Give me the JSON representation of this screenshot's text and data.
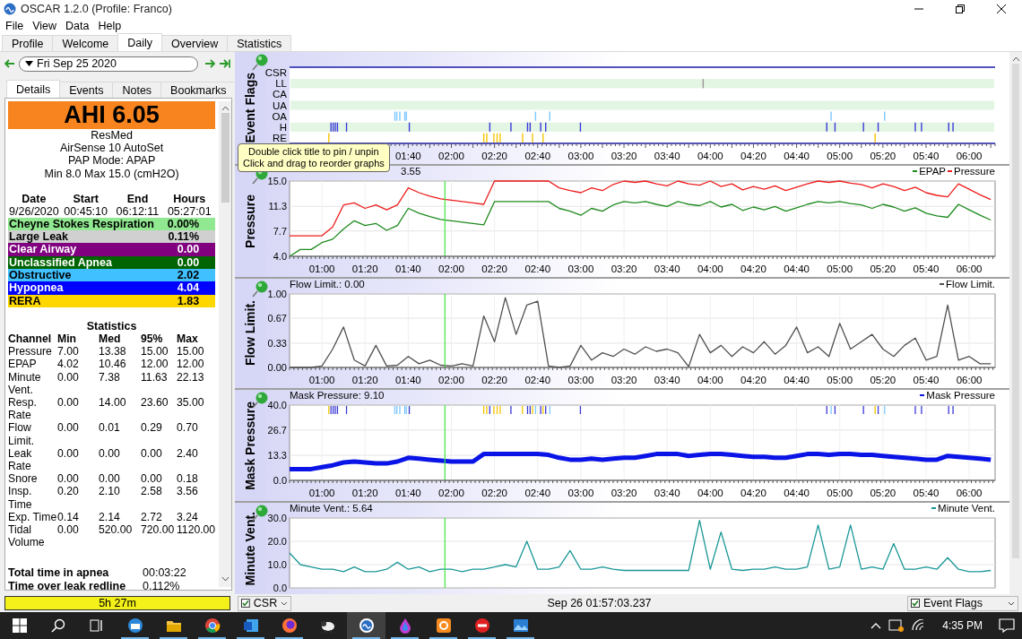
{
  "window": {
    "title": "OSCAR 1.2.0 (Profile: Franco)"
  },
  "menu": [
    "File",
    "View",
    "Data",
    "Help"
  ],
  "tabs": [
    {
      "label": "Profile",
      "selected": false
    },
    {
      "label": "Welcome",
      "selected": false
    },
    {
      "label": "Daily",
      "selected": true
    },
    {
      "label": "Overview",
      "selected": false
    },
    {
      "label": "Statistics",
      "selected": false
    }
  ],
  "date_nav": {
    "date": "Fri Sep 25 2020"
  },
  "detail_tabs": [
    {
      "label": "Details",
      "selected": true
    },
    {
      "label": "Events",
      "selected": false
    },
    {
      "label": "Notes",
      "selected": false
    },
    {
      "label": "Bookmarks",
      "selected": false
    }
  ],
  "summary": {
    "ahi": "AHI 6.05",
    "device_lines": [
      "ResMed",
      "AirSense 10 AutoSet",
      "PAP Mode: APAP",
      "Min 8.0 Max 15.0 (cmH2O)"
    ]
  },
  "session": {
    "columns": [
      "Date",
      "Start",
      "End",
      "Hours"
    ],
    "values": [
      "9/26/2020",
      "00:45:10",
      "06:12:11",
      "05:27:01"
    ]
  },
  "event_rates": [
    {
      "name": "Cheyne Stokes Respiration",
      "value": "0.00%",
      "color": "#90e890"
    },
    {
      "name": "Large Leak",
      "value": "0.11%",
      "color": "#d0d0d0"
    },
    {
      "name": "Clear Airway",
      "value": "0.00",
      "color": "#800080"
    },
    {
      "name": "Unclassified Apnea",
      "value": "0.00",
      "color": "#006400"
    },
    {
      "name": "Obstructive",
      "value": "2.02",
      "color": "#40c0ff"
    },
    {
      "name": "Hypopnea",
      "value": "4.04",
      "color": "#0000ff"
    },
    {
      "name": "RERA",
      "value": "1.83",
      "color": "#ffd700"
    }
  ],
  "statistics": {
    "title": "Statistics",
    "columns": [
      "Channel",
      "Min",
      "Med",
      "95%",
      "Max"
    ],
    "rows": [
      [
        "Pressure",
        "7.00",
        "13.38",
        "15.00",
        "15.00"
      ],
      [
        "EPAP",
        "4.02",
        "10.46",
        "12.00",
        "12.00"
      ],
      [
        "Minute Vent.",
        "0.00",
        "7.38",
        "11.63",
        "22.13"
      ],
      [
        "Resp. Rate",
        "0.00",
        "14.00",
        "23.60",
        "35.00"
      ],
      [
        "Flow Limit.",
        "0.00",
        "0.01",
        "0.29",
        "0.70"
      ],
      [
        "Leak Rate",
        "0.00",
        "0.00",
        "0.00",
        "2.40"
      ],
      [
        "Snore",
        "0.00",
        "0.00",
        "0.00",
        "0.18"
      ],
      [
        "Insp. Time",
        "0.20",
        "2.10",
        "2.58",
        "3.56"
      ],
      [
        "Exp. Time",
        "0.14",
        "2.14",
        "2.72",
        "3.24"
      ],
      [
        "Tidal Volume",
        "0.00",
        "520.00",
        "720.00",
        "1120.00"
      ]
    ]
  },
  "totals": [
    {
      "label": "Total time in apnea",
      "value": "00:03:22"
    },
    {
      "label": "Time over leak redline",
      "value": "0.112%"
    }
  ],
  "usage": "5h 27m",
  "graphs": [
    {
      "kind": "flags",
      "ylabel": "Event Flags",
      "rows": [
        {
          "label": "CSR"
        },
        {
          "label": "LL"
        },
        {
          "label": "CA"
        },
        {
          "label": "UA"
        },
        {
          "label": "OA"
        },
        {
          "label": "H"
        },
        {
          "label": "RE"
        }
      ],
      "time_labels": [
        "01:40",
        "02:00",
        "02:20",
        "02:40",
        "03:00",
        "03:20",
        "03:40",
        "04:00",
        "04:20",
        "04:40",
        "05:00",
        "05:20",
        "05:40",
        "06:00"
      ]
    },
    {
      "kind": "chart",
      "title": "3.55",
      "title_cut": true,
      "chart_data": {
        "type": "line",
        "ylabel": "Pressure",
        "xlim": [
          45,
          372
        ],
        "ylim": [
          4,
          15
        ],
        "grid": true,
        "yticks": [
          {
            "value": 4,
            "label": "4.0"
          },
          {
            "value": 7.7,
            "label": "7.7"
          },
          {
            "value": 11.3,
            "label": "11.3"
          },
          {
            "value": 15,
            "label": "15.0"
          }
        ],
        "xticks": [
          {
            "value": 60,
            "label": "01:00"
          },
          {
            "value": 80,
            "label": "01:20"
          },
          {
            "value": 100,
            "label": "01:40"
          },
          {
            "value": 120,
            "label": "02:00"
          },
          {
            "value": 140,
            "label": "02:20"
          },
          {
            "value": 160,
            "label": "02:40"
          },
          {
            "value": 180,
            "label": "03:00"
          },
          {
            "value": 200,
            "label": "03:20"
          },
          {
            "value": 220,
            "label": "03:40"
          },
          {
            "value": 240,
            "label": "04:00"
          },
          {
            "value": 260,
            "label": "04:20"
          },
          {
            "value": 280,
            "label": "04:40"
          },
          {
            "value": 300,
            "label": "05:00"
          },
          {
            "value": 320,
            "label": "05:20"
          },
          {
            "value": 340,
            "label": "05:40"
          },
          {
            "value": 360,
            "label": "06:00"
          }
        ],
        "ref_lines": [
          {
            "axis": "x",
            "value": 117,
            "color": "#3ee83e"
          }
        ],
        "x": [
          45,
          50,
          55,
          60,
          65,
          70,
          75,
          80,
          85,
          90,
          95,
          100,
          105,
          110,
          115,
          120,
          125,
          130,
          135,
          140,
          145,
          150,
          155,
          160,
          165,
          170,
          175,
          180,
          185,
          190,
          195,
          200,
          205,
          210,
          215,
          220,
          225,
          230,
          235,
          240,
          245,
          250,
          255,
          260,
          265,
          270,
          275,
          280,
          285,
          290,
          295,
          300,
          305,
          310,
          315,
          320,
          325,
          330,
          335,
          340,
          345,
          350,
          355,
          360,
          365,
          370
        ],
        "series": [
          {
            "name": "EPAP",
            "color": "#1e8a1e",
            "values": [
              4.0,
              5.0,
              5.0,
              6.0,
              6.5,
              8.0,
              9.2,
              8.5,
              8.8,
              7.8,
              8.5,
              11.0,
              10.3,
              9.8,
              9.4,
              9.2,
              9.0,
              8.8,
              8.6,
              12.0,
              12.0,
              12.0,
              12.0,
              12.0,
              12.0,
              11.0,
              10.6,
              10.0,
              11.0,
              10.6,
              11.5,
              12.0,
              11.8,
              12.0,
              11.6,
              11.3,
              12.0,
              11.6,
              11.4,
              12.0,
              11.2,
              11.6,
              10.7,
              11.2,
              10.8,
              11.3,
              10.6,
              11.1,
              11.6,
              12.0,
              11.8,
              12.0,
              11.7,
              11.5,
              11.0,
              11.6,
              11.2,
              10.6,
              11.1,
              10.3,
              9.9,
              9.7,
              11.6,
              10.8,
              10.0,
              9.3
            ]
          },
          {
            "name": "Pressure",
            "color": "#ee1c1c",
            "values": [
              7.0,
              7.0,
              7.0,
              7.0,
              8.3,
              11.5,
              11.8,
              11.0,
              11.5,
              10.8,
              11.5,
              14.0,
              13.3,
              12.8,
              12.4,
              12.2,
              12.0,
              11.8,
              11.6,
              15.0,
              15.0,
              15.0,
              15.0,
              15.0,
              15.0,
              14.0,
              13.6,
              13.3,
              14.0,
              13.6,
              14.5,
              15.0,
              14.8,
              15.0,
              14.6,
              14.3,
              15.0,
              14.6,
              14.4,
              15.0,
              14.2,
              14.6,
              13.7,
              14.2,
              13.8,
              14.3,
              13.6,
              14.1,
              14.6,
              15.0,
              14.8,
              15.0,
              14.7,
              14.5,
              14.0,
              14.6,
              14.2,
              13.6,
              14.1,
              13.3,
              12.9,
              12.7,
              14.6,
              13.8,
              13.0,
              12.3
            ]
          }
        ]
      }
    },
    {
      "kind": "chart",
      "title": "Flow Limit.: 0.00",
      "chart_data": {
        "type": "line",
        "ylabel": "Flow Limit.",
        "xlim": [
          45,
          372
        ],
        "ylim": [
          0,
          1
        ],
        "grid": true,
        "yticks": [
          {
            "value": 0,
            "label": "0.00"
          },
          {
            "value": 0.33,
            "label": "0.33"
          },
          {
            "value": 0.67,
            "label": "0.67"
          },
          {
            "value": 1,
            "label": "1.00"
          }
        ],
        "xticks": [
          {
            "value": 60,
            "label": "01:00"
          },
          {
            "value": 80,
            "label": "01:20"
          },
          {
            "value": 100,
            "label": "01:40"
          },
          {
            "value": 120,
            "label": "02:00"
          },
          {
            "value": 140,
            "label": "02:20"
          },
          {
            "value": 160,
            "label": "02:40"
          },
          {
            "value": 180,
            "label": "03:00"
          },
          {
            "value": 200,
            "label": "03:20"
          },
          {
            "value": 220,
            "label": "03:40"
          },
          {
            "value": 240,
            "label": "04:00"
          },
          {
            "value": 260,
            "label": "04:20"
          },
          {
            "value": 280,
            "label": "04:40"
          },
          {
            "value": 300,
            "label": "05:00"
          },
          {
            "value": 320,
            "label": "05:20"
          },
          {
            "value": 340,
            "label": "05:40"
          },
          {
            "value": 360,
            "label": "06:00"
          }
        ],
        "ref_lines": [
          {
            "axis": "x",
            "value": 117,
            "color": "#3ee83e"
          }
        ],
        "x": [
          45,
          50,
          55,
          60,
          65,
          70,
          75,
          80,
          85,
          90,
          95,
          100,
          105,
          110,
          115,
          120,
          125,
          130,
          135,
          140,
          145,
          150,
          155,
          160,
          165,
          170,
          175,
          180,
          185,
          190,
          195,
          200,
          205,
          210,
          215,
          220,
          225,
          230,
          235,
          240,
          245,
          250,
          255,
          260,
          265,
          270,
          275,
          280,
          285,
          290,
          295,
          300,
          305,
          310,
          315,
          320,
          325,
          330,
          335,
          340,
          345,
          350,
          355,
          360,
          365,
          370
        ],
        "series": [
          {
            "name": "Flow Limit.",
            "color": "#505050",
            "values": [
              0.0,
              0.0,
              0.0,
              0.02,
              0.25,
              0.55,
              0.1,
              0.02,
              0.3,
              0.02,
              0.03,
              0.15,
              0.05,
              0.1,
              0.03,
              0.02,
              0.05,
              0.02,
              0.7,
              0.35,
              0.95,
              0.45,
              0.85,
              0.9,
              0.02,
              0.0,
              0.02,
              0.3,
              0.1,
              0.2,
              0.15,
              0.25,
              0.18,
              0.28,
              0.22,
              0.25,
              0.2,
              0.01,
              0.45,
              0.2,
              0.3,
              0.15,
              0.28,
              0.2,
              0.35,
              0.18,
              0.3,
              0.55,
              0.2,
              0.28,
              0.15,
              0.6,
              0.25,
              0.35,
              0.45,
              0.25,
              0.15,
              0.3,
              0.4,
              0.1,
              0.15,
              0.85,
              0.1,
              0.15,
              0.05,
              0.05
            ]
          }
        ]
      }
    },
    {
      "kind": "chart",
      "title": "Mask Pressure: 9.10",
      "chart_data": {
        "type": "line",
        "ylabel": "Mask Pressure",
        "xlim": [
          45,
          372
        ],
        "ylim": [
          0,
          40
        ],
        "grid": true,
        "yticks": [
          {
            "value": 0,
            "label": "0.0"
          },
          {
            "value": 13.3,
            "label": "13.3"
          },
          {
            "value": 26.7,
            "label": "26.7"
          },
          {
            "value": 40,
            "label": "40.0"
          }
        ],
        "xticks": [
          {
            "value": 60,
            "label": "01:00"
          },
          {
            "value": 80,
            "label": "01:20"
          },
          {
            "value": 100,
            "label": "01:40"
          },
          {
            "value": 120,
            "label": "02:00"
          },
          {
            "value": 140,
            "label": "02:20"
          },
          {
            "value": 160,
            "label": "02:40"
          },
          {
            "value": 180,
            "label": "03:00"
          },
          {
            "value": 200,
            "label": "03:20"
          },
          {
            "value": 220,
            "label": "03:40"
          },
          {
            "value": 240,
            "label": "04:00"
          },
          {
            "value": 260,
            "label": "04:20"
          },
          {
            "value": 280,
            "label": "04:40"
          },
          {
            "value": 300,
            "label": "05:00"
          },
          {
            "value": 320,
            "label": "05:20"
          },
          {
            "value": 340,
            "label": "05:40"
          },
          {
            "value": 360,
            "label": "06:00"
          }
        ],
        "ref_lines": [
          {
            "axis": "x",
            "value": 117,
            "color": "#3ee83e"
          }
        ],
        "x": [
          45,
          50,
          55,
          60,
          65,
          70,
          75,
          80,
          85,
          90,
          95,
          100,
          105,
          110,
          115,
          120,
          125,
          130,
          135,
          140,
          145,
          150,
          155,
          160,
          165,
          170,
          175,
          180,
          185,
          190,
          195,
          200,
          205,
          210,
          215,
          220,
          225,
          230,
          235,
          240,
          245,
          250,
          255,
          260,
          265,
          270,
          275,
          280,
          285,
          290,
          295,
          300,
          305,
          310,
          315,
          320,
          325,
          330,
          335,
          340,
          345,
          350,
          355,
          360,
          365,
          370
        ],
        "series": [
          {
            "name": "Mask Pressure",
            "color": "#0a14e6",
            "values": [
              6,
              6,
              6,
              7,
              8,
              9.5,
              10,
              9.5,
              9,
              9,
              10,
              12,
              11.5,
              11,
              10.5,
              10,
              10,
              10,
              14,
              14,
              14,
              14,
              14,
              14,
              13.5,
              12,
              11,
              11,
              11.5,
              11,
              11.5,
              12,
              12,
              13,
              14,
              14,
              14,
              13,
              13.5,
              14,
              14,
              13.5,
              13,
              12.5,
              12.5,
              12,
              12,
              13,
              14,
              14,
              13.5,
              14,
              14,
              13.5,
              13.5,
              13,
              12.5,
              12,
              11.5,
              11,
              11,
              13,
              12.5,
              12,
              11.5,
              11
            ]
          }
        ]
      }
    },
    {
      "kind": "chart",
      "title": "Minute Vent.: 5.64",
      "chart_data": {
        "type": "line",
        "ylabel": "Minute Vent.",
        "xlim": [
          45,
          372
        ],
        "ylim": [
          0,
          30
        ],
        "grid": true,
        "yticks": [
          {
            "value": 0,
            "label": "0.0"
          },
          {
            "value": 10,
            "label": "10.0"
          },
          {
            "value": 20,
            "label": "20.0"
          },
          {
            "value": 30,
            "label": "30.0"
          }
        ],
        "ref_lines": [
          {
            "axis": "x",
            "value": 117,
            "color": "#3ee83e"
          }
        ],
        "x": [
          45,
          50,
          55,
          60,
          65,
          70,
          75,
          80,
          85,
          90,
          95,
          100,
          105,
          110,
          115,
          120,
          125,
          130,
          135,
          140,
          145,
          150,
          155,
          160,
          165,
          170,
          175,
          180,
          185,
          190,
          195,
          200,
          205,
          210,
          215,
          220,
          225,
          230,
          235,
          240,
          245,
          250,
          255,
          260,
          265,
          270,
          275,
          280,
          285,
          290,
          295,
          300,
          305,
          310,
          315,
          320,
          325,
          330,
          335,
          340,
          345,
          350,
          355,
          360,
          365,
          370
        ],
        "series": [
          {
            "name": "Minute Vent.",
            "color": "#1a9696",
            "values": [
              15,
              10,
              9,
              8,
              8,
              7,
              9,
              7,
              7,
              8,
              11,
              8,
              9,
              7,
              8,
              8,
              7,
              8,
              8,
              9,
              10,
              9,
              20,
              8,
              8,
              9,
              16,
              8,
              8,
              9,
              8,
              7.5,
              7.5,
              7.5,
              7.5,
              7.5,
              7.5,
              7.5,
              29,
              8,
              24,
              8,
              7.5,
              8,
              8,
              9,
              8,
              8,
              9,
              27,
              8,
              9,
              27,
              8,
              9,
              8,
              19,
              8,
              8,
              9,
              8,
              13,
              8,
              7,
              7,
              7.5
            ]
          }
        ]
      }
    }
  ],
  "tooltip": {
    "lines": [
      "Double click title to pin / unpin",
      "Click and drag to reorder graphs"
    ]
  },
  "status_bar": {
    "left_combo": {
      "label": "CSR",
      "checked": true
    },
    "time": "Sep 26 01:57:03.237",
    "right_combo": {
      "label": "Event Flags",
      "checked": true
    }
  },
  "taskbar": {
    "apps": [
      {
        "kind": "mail",
        "running": true,
        "selected": false
      },
      {
        "kind": "folder",
        "running": true,
        "selected": false
      },
      {
        "kind": "chrome",
        "running": true,
        "selected": false
      },
      {
        "kind": "word",
        "running": true,
        "selected": false
      },
      {
        "kind": "firefox",
        "running": true,
        "selected": false
      },
      {
        "kind": "sheep",
        "running": false,
        "selected": false
      },
      {
        "kind": "oscar",
        "running": true,
        "selected": true
      },
      {
        "kind": "drop",
        "running": true,
        "selected": false
      },
      {
        "kind": "orange",
        "running": true,
        "selected": false
      },
      {
        "kind": "stop",
        "running": true,
        "selected": false
      },
      {
        "kind": "photo",
        "running": true,
        "selected": false
      }
    ],
    "clock": "4:35 PM"
  }
}
